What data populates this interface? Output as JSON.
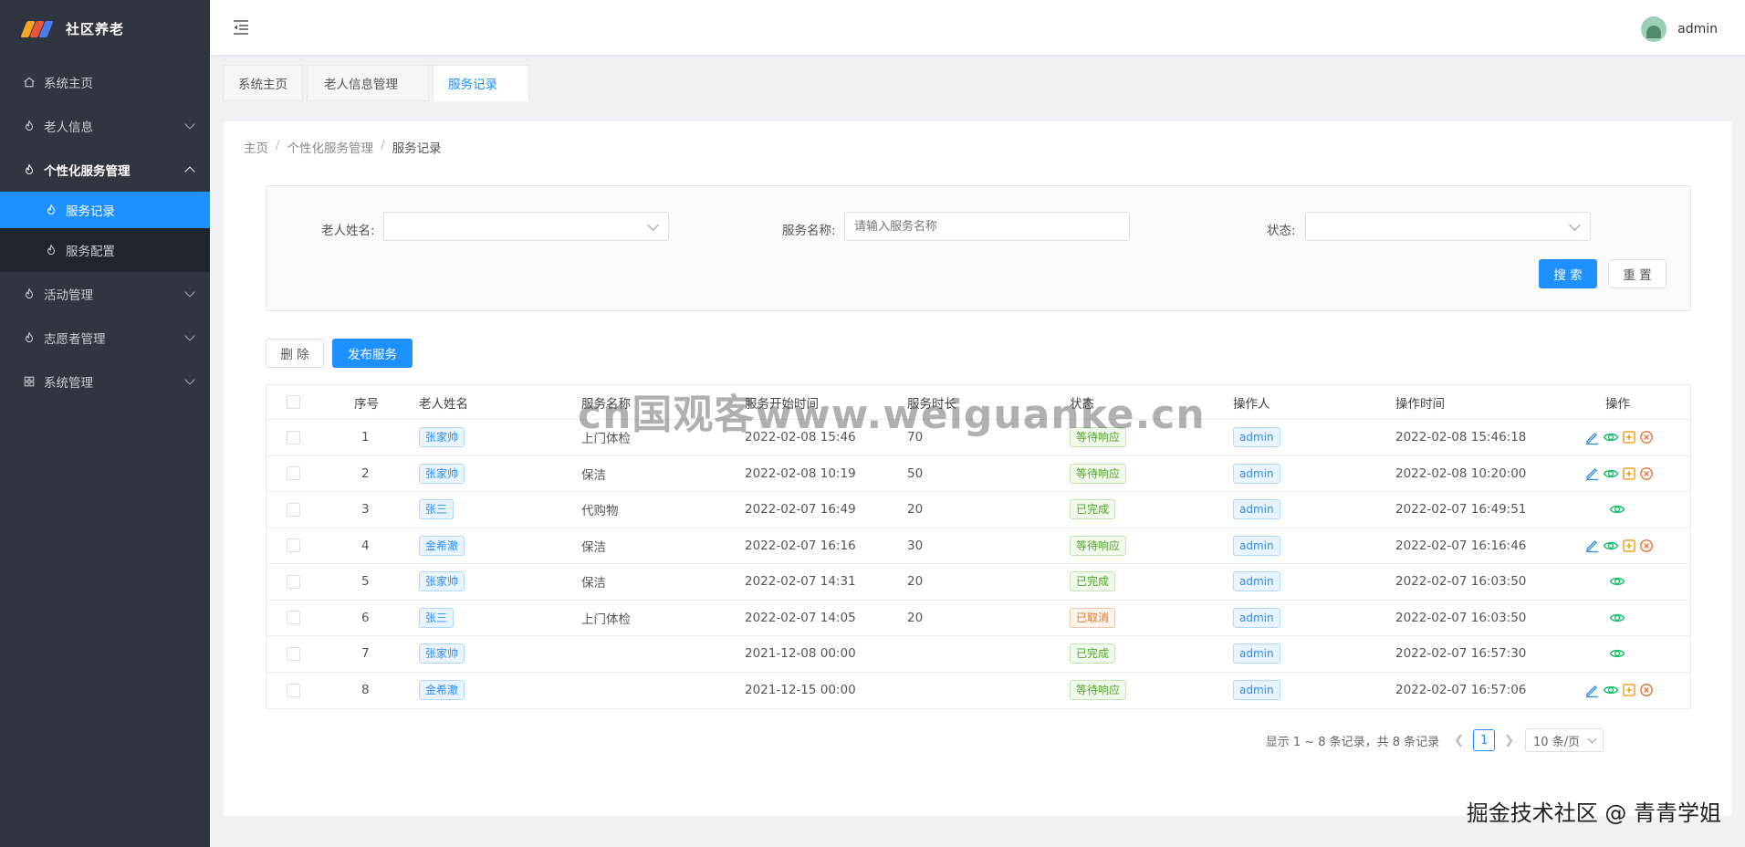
{
  "app": {
    "title": "社区养老"
  },
  "sidebar": {
    "items": [
      {
        "label": "系统主页",
        "icon": "home-icon"
      },
      {
        "label": "老人信息",
        "icon": "flame-icon"
      },
      {
        "label": "个性化服务管理",
        "icon": "flame-icon"
      },
      {
        "label": "服务记录",
        "icon": "flame-icon"
      },
      {
        "label": "服务配置",
        "icon": "flame-icon"
      },
      {
        "label": "活动管理",
        "icon": "flame-icon"
      },
      {
        "label": "志愿者管理",
        "icon": "flame-icon"
      },
      {
        "label": "系统管理",
        "icon": "grid-icon"
      }
    ]
  },
  "header": {
    "username": "admin"
  },
  "tabs": [
    {
      "label": "系统主页"
    },
    {
      "label": "老人信息管理"
    },
    {
      "label": "服务记录"
    }
  ],
  "breadcrumb": [
    "主页",
    "个性化服务管理",
    "服务记录"
  ],
  "search": {
    "elder_label": "老人姓名:",
    "elder_value": "",
    "service_label": "服务名称:",
    "service_placeholder": "请输入服务名称",
    "status_label": "状态:",
    "status_value": "",
    "search_button": "搜 索",
    "reset_button": "重 置"
  },
  "toolbar": {
    "delete_button": "删 除",
    "publish_button": "发布服务"
  },
  "table": {
    "headers": [
      "序号",
      "老人姓名",
      "服务名称",
      "服务开始时间",
      "服务时长",
      "状态",
      "操作人",
      "操作时间",
      "操作"
    ],
    "rows": [
      {
        "no": "1",
        "name": "张家帅",
        "service": "上门体检",
        "start": "2022-02-08 15:46",
        "duration": "70",
        "status": "等待响应",
        "operator": "admin",
        "optime": "2022-02-08 15:46:18"
      },
      {
        "no": "2",
        "name": "张家帅",
        "service": "保洁",
        "start": "2022-02-08 10:19",
        "duration": "50",
        "status": "等待响应",
        "operator": "admin",
        "optime": "2022-02-08 10:20:00"
      },
      {
        "no": "3",
        "name": "张三",
        "service": "代购物",
        "start": "2022-02-07 16:49",
        "duration": "20",
        "status": "已完成",
        "operator": "admin",
        "optime": "2022-02-07 16:49:51"
      },
      {
        "no": "4",
        "name": "金希澈",
        "service": "保洁",
        "start": "2022-02-07 16:16",
        "duration": "30",
        "status": "等待响应",
        "operator": "admin",
        "optime": "2022-02-07 16:16:46"
      },
      {
        "no": "5",
        "name": "张家帅",
        "service": "保洁",
        "start": "2022-02-07 14:31",
        "duration": "20",
        "status": "已完成",
        "operator": "admin",
        "optime": "2022-02-07 16:03:50"
      },
      {
        "no": "6",
        "name": "张三",
        "service": "上门体检",
        "start": "2022-02-07 14:05",
        "duration": "20",
        "status": "已取消",
        "operator": "admin",
        "optime": "2022-02-07 16:03:50"
      },
      {
        "no": "7",
        "name": "张家帅",
        "service": "",
        "start": "2021-12-08 00:00",
        "duration": "",
        "status": "已完成",
        "operator": "admin",
        "optime": "2022-02-07 16:57:30"
      },
      {
        "no": "8",
        "name": "金希澈",
        "service": "",
        "start": "2021-12-15 00:00",
        "duration": "",
        "status": "等待响应",
        "operator": "admin",
        "optime": "2022-02-07 16:57:06"
      }
    ]
  },
  "pagination": {
    "summary": "显示 1 ~ 8 条记录，共 8 条记录",
    "current_page": "1",
    "page_size": "10 条/页"
  },
  "watermarks": {
    "center": "cn国观客www.weiguanke.cn",
    "footer": "掘金技术社区 @ 青青学姐"
  },
  "colors": {
    "primary": "#1e90ff",
    "sidebar_bg": "#30363f",
    "success": "#52a329",
    "warning": "#e6762b"
  }
}
